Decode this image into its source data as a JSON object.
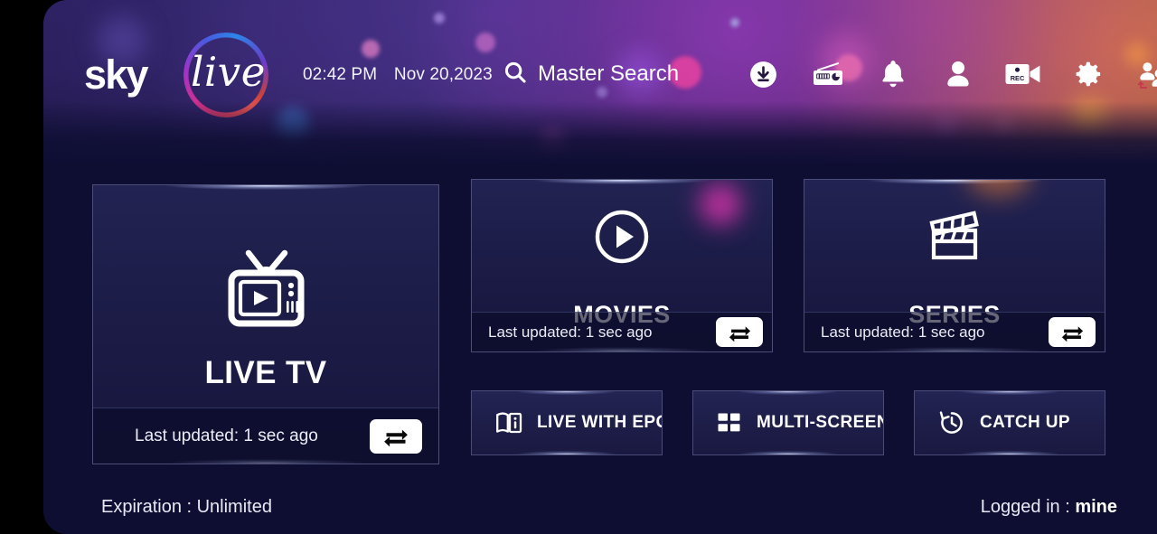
{
  "app": {
    "background_color": "#0e0e33",
    "frame_color": "#000000"
  },
  "header": {
    "logo": {
      "primary_text": "sky",
      "secondary_text": "live",
      "ring_icon": "gradient-ring-icon"
    },
    "time": "02:42 PM",
    "date": "Nov 20,2023",
    "search": {
      "icon": "search-icon",
      "label": "Master Search"
    },
    "icons": [
      {
        "name": "download-icon",
        "label": "Download"
      },
      {
        "name": "radio-icon",
        "label": "Radio"
      },
      {
        "name": "bell-icon",
        "label": "Notifications"
      },
      {
        "name": "person-icon",
        "label": "Account"
      },
      {
        "name": "rec-camera-icon",
        "label": "REC"
      },
      {
        "name": "gear-icon",
        "label": "Settings"
      },
      {
        "name": "switch-user-icon",
        "label": "Switch User"
      }
    ],
    "rec_badge_text": "REC"
  },
  "tiles": [
    {
      "id": "live-tv",
      "title": "LIVE TV",
      "icon": "retro-tv-icon",
      "updated_text": "Last updated: 1 sec ago",
      "refresh_icon": "refresh-swap-icon"
    },
    {
      "id": "movies",
      "title": "MOVIES",
      "icon": "play-circle-icon",
      "updated_text": "Last updated: 1 sec ago",
      "refresh_icon": "refresh-swap-icon"
    },
    {
      "id": "series",
      "title": "SERIES",
      "icon": "clapperboard-icon",
      "updated_text": "Last updated: 1 sec ago",
      "refresh_icon": "refresh-swap-icon"
    }
  ],
  "actions": [
    {
      "id": "live-with-epg",
      "label": "LIVE WITH EPG",
      "icon": "book-info-icon"
    },
    {
      "id": "multi-screen",
      "label": "MULTI-SCREEN",
      "icon": "grid-four-icon"
    },
    {
      "id": "catch-up",
      "label": "CATCH UP",
      "icon": "history-clock-icon"
    }
  ],
  "footer": {
    "expiration_label": "Expiration : Unlimited",
    "logged_in_label": "Logged in : ",
    "logged_in_user": "mine"
  }
}
